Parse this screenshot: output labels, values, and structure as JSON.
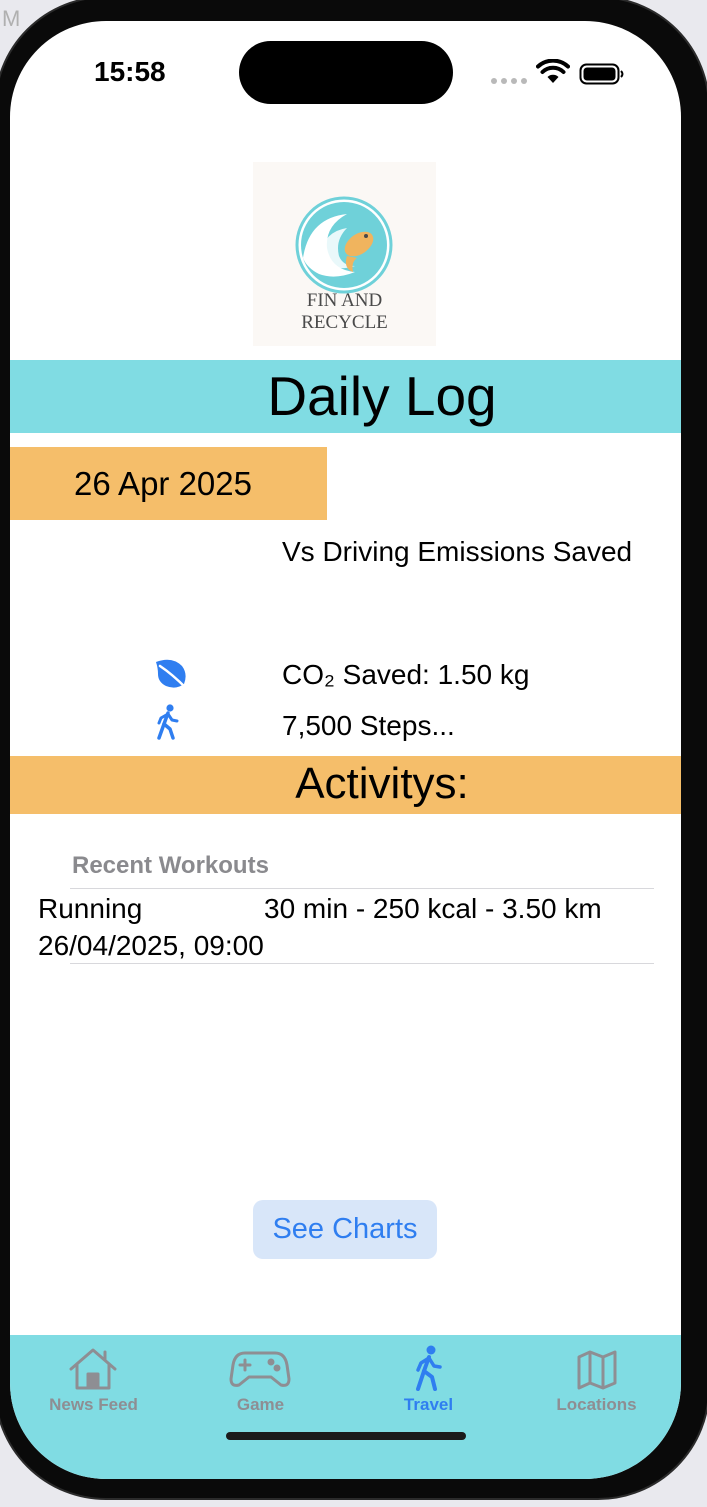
{
  "background": {
    "window_text": "M"
  },
  "status_bar": {
    "time": "15:58"
  },
  "logo": {
    "line1": "FIN AND",
    "line2": "RECYCLE"
  },
  "header": {
    "title": "Daily Log"
  },
  "date": {
    "label": "26 Apr 2025"
  },
  "comparison": {
    "label": "Vs Driving Emissions Saved"
  },
  "stats": {
    "co2_prefix": "CO",
    "co2_sub": "₂",
    "co2_rest": " Saved: 1.50 kg",
    "co2_icon": "leaf-icon",
    "steps": "7,500 Steps...",
    "steps_icon": "walk-icon"
  },
  "activities": {
    "title": "Activitys:",
    "section_header": "Recent Workouts",
    "workouts": [
      {
        "name": "Running",
        "stats": "30 min - 250 kcal - 3.50 km",
        "time": "26/04/2025, 09:00"
      }
    ]
  },
  "buttons": {
    "see_charts": "See Charts"
  },
  "tabs": [
    {
      "label": "News Feed",
      "icon": "house-icon",
      "active": false
    },
    {
      "label": "Game",
      "icon": "gamecontroller-icon",
      "active": false
    },
    {
      "label": "Travel",
      "icon": "walk-icon",
      "active": true
    },
    {
      "label": "Locations",
      "icon": "map-icon",
      "active": false
    }
  ],
  "colors": {
    "teal": "#80dce3",
    "orange": "#f5be6a",
    "accent_blue": "#2f7ef0",
    "inactive_gray": "#8e8e93"
  }
}
